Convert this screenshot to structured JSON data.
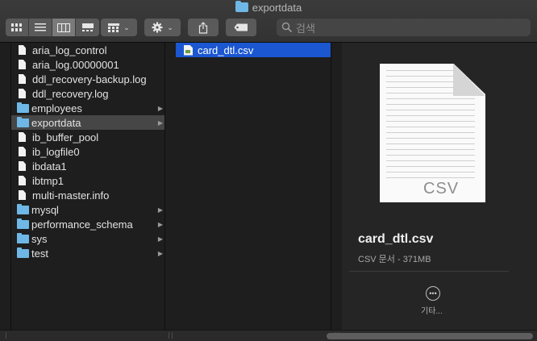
{
  "window": {
    "title": "exportdata"
  },
  "search": {
    "placeholder": "검색"
  },
  "column1": [
    {
      "name": "aria_log_control",
      "kind": "file"
    },
    {
      "name": "aria_log.00000001",
      "kind": "file"
    },
    {
      "name": "ddl_recovery-backup.log",
      "kind": "file"
    },
    {
      "name": "ddl_recovery.log",
      "kind": "file"
    },
    {
      "name": "employees",
      "kind": "folder"
    },
    {
      "name": "exportdata",
      "kind": "folder",
      "selected": true
    },
    {
      "name": "ib_buffer_pool",
      "kind": "file"
    },
    {
      "name": "ib_logfile0",
      "kind": "file"
    },
    {
      "name": "ibdata1",
      "kind": "file"
    },
    {
      "name": "ibtmp1",
      "kind": "file"
    },
    {
      "name": "multi-master.info",
      "kind": "file"
    },
    {
      "name": "mysql",
      "kind": "folder"
    },
    {
      "name": "performance_schema",
      "kind": "folder"
    },
    {
      "name": "sys",
      "kind": "folder"
    },
    {
      "name": "test",
      "kind": "folder"
    }
  ],
  "column2": [
    {
      "name": "card_dtl.csv",
      "kind": "csv",
      "selected": true
    }
  ],
  "preview": {
    "icon_text": "CSV",
    "filename": "card_dtl.csv",
    "info": "CSV 문서 - 371MB",
    "more_label": "기타..."
  },
  "colors": {
    "selection": "#1b57d1",
    "folder": "#6eb7e6",
    "background": "#1e1e1e"
  }
}
